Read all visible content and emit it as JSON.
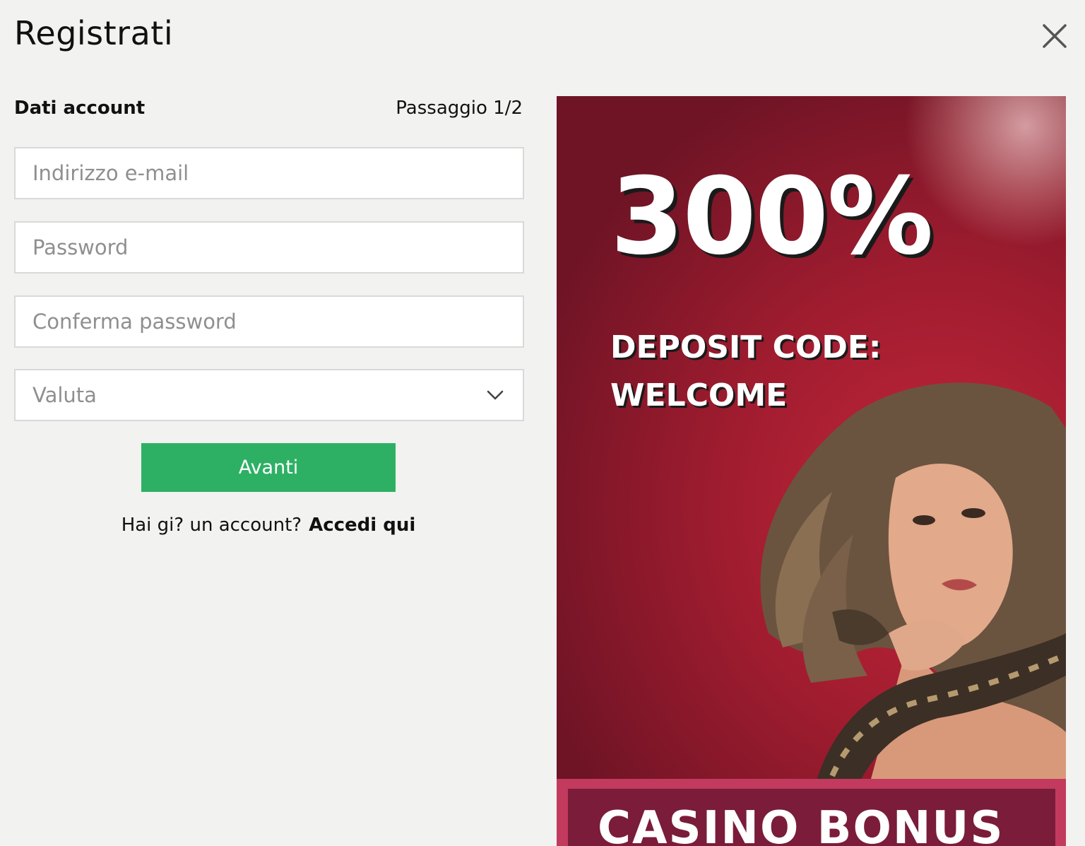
{
  "header": {
    "title": "Registrati",
    "close_icon": "close-icon"
  },
  "form": {
    "section_label": "Dati account",
    "step_label": "Passaggio 1/2",
    "email": {
      "value": "",
      "placeholder": "Indirizzo e-mail"
    },
    "password": {
      "value": "",
      "placeholder": "Password"
    },
    "confirm_password": {
      "value": "",
      "placeholder": "Conferma password"
    },
    "currency": {
      "selected": "Valuta",
      "icon": "chevron-down-icon"
    },
    "next_label": "Avanti",
    "login_prompt": "Hai gi? un account?",
    "login_link": "Accedi qui"
  },
  "banner": {
    "headline": "300%",
    "code_line1": "DEPOSIT CODE:",
    "code_line2": "WELCOME",
    "footer": "CASINO BONUS",
    "colors": {
      "background": "#a01c2f",
      "footer": "#c33a5f"
    }
  },
  "colors": {
    "page_background": "#f2f2f1",
    "primary_button": "#2db064",
    "field_border": "#d9d9d9"
  }
}
